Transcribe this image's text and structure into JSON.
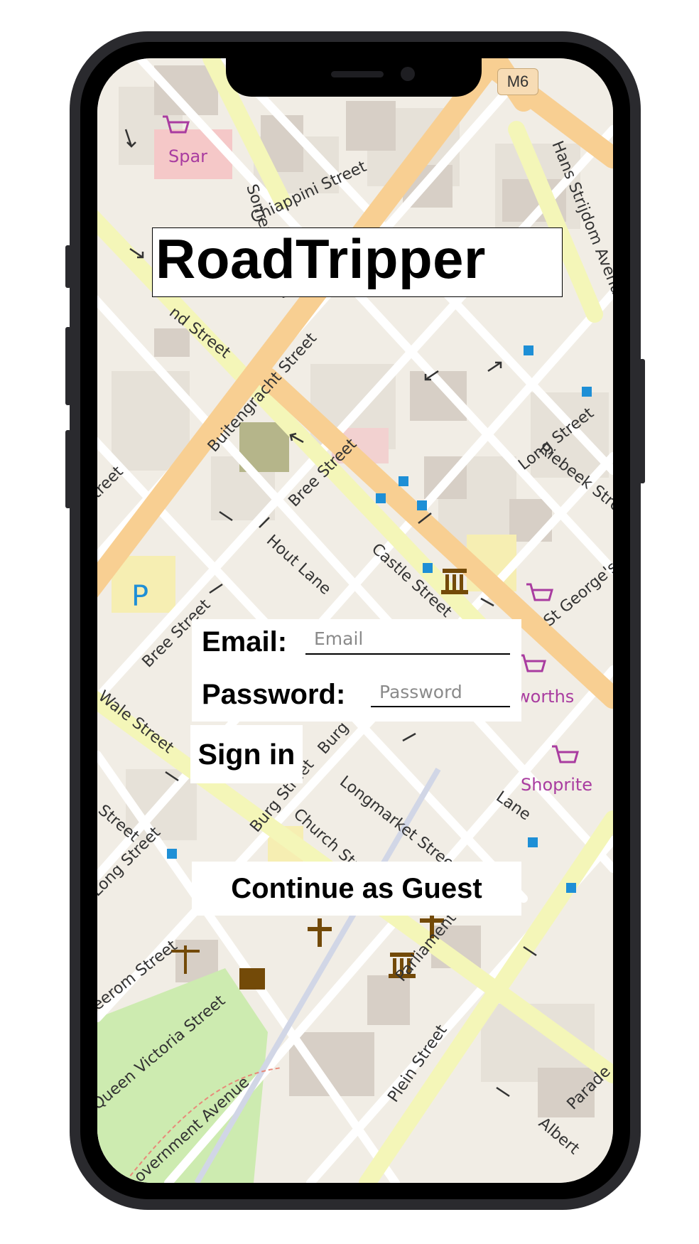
{
  "app": {
    "title": "RoadTripper"
  },
  "form": {
    "email_label": "Email:",
    "email_placeholder": "Email",
    "email_value": "",
    "password_label": "Password:",
    "password_placeholder": "Password",
    "password_value": ""
  },
  "actions": {
    "signin_label": "Sign in",
    "guest_label": "Continue as Guest"
  },
  "map": {
    "road_sign": "M6",
    "streets": [
      "Somerset Road",
      "Chiappini Street",
      "Hans Strijdom Avenue",
      "Buitengracht Street",
      "Bree Street",
      "Long Street",
      "Riebeek Street",
      "Hout Lane",
      "Castle Street",
      "St George's Mall",
      "Bree Street",
      "Wale Street",
      "Burg Street",
      "Church Street",
      "Longmarket Street",
      "Long Street",
      "Queen Victoria Street",
      "Government Avenue",
      "Plein Street",
      "Parliament Street",
      "Albert",
      "Parade",
      "Street",
      "Street",
      "Lane",
      "Shoprite",
      "Spar",
      "Woolworths"
    ],
    "colors": {
      "land": "#f1ede5",
      "block": "#e2ddd4",
      "building": "#d7cfc6",
      "primary_road": "#f8cf92",
      "secondary_road": "#f4f6b8",
      "park": "#cdebb0",
      "poi_shop": "#a93ca0",
      "poi_bus": "#1e8fd6",
      "poi_amenity": "#734a08"
    }
  }
}
